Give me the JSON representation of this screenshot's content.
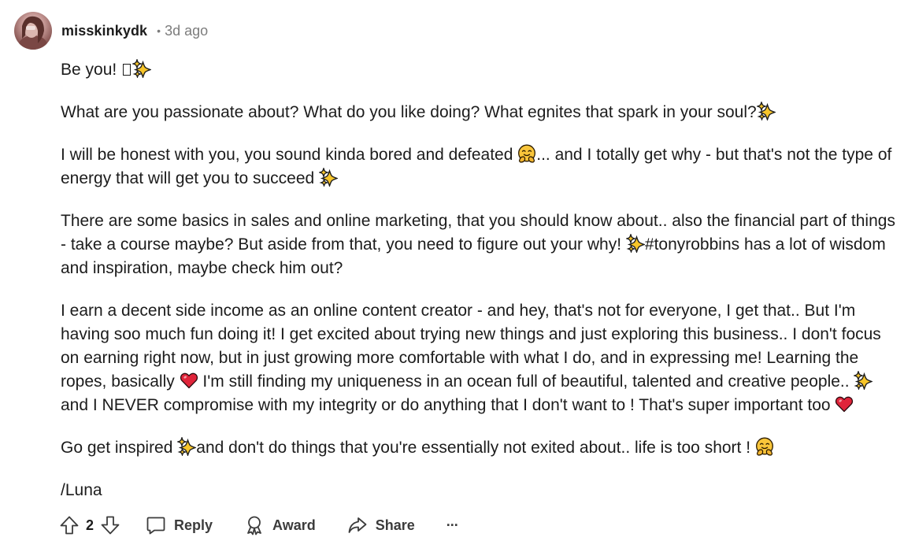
{
  "comment": {
    "author": "misskinkydk",
    "separator": "•",
    "timestamp": "3d ago",
    "paragraphs": [
      {
        "parts": [
          {
            "t": "text",
            "v": "Be you! "
          },
          {
            "t": "missing"
          },
          {
            "t": "sparkle"
          }
        ]
      },
      {
        "parts": [
          {
            "t": "text",
            "v": "What are you passionate about? What do you like doing? What egnites that spark in your soul?"
          },
          {
            "t": "sparkle"
          }
        ]
      },
      {
        "parts": [
          {
            "t": "text",
            "v": "I will be honest with you, you sound kinda bored and defeated "
          },
          {
            "t": "hug"
          },
          {
            "t": "text",
            "v": "... and I totally get why - but that's not the type of energy that will get you to succeed "
          },
          {
            "t": "sparkle"
          }
        ]
      },
      {
        "parts": [
          {
            "t": "text",
            "v": "There are some basics in sales and online marketing, that you should know about.. also the financial part of things - take a course maybe? But aside from that, you need to figure out your why! "
          },
          {
            "t": "sparkle"
          },
          {
            "t": "text",
            "v": "#tonyrobbins has a lot of wisdom and inspiration, maybe check him out?"
          }
        ]
      },
      {
        "parts": [
          {
            "t": "text",
            "v": "I earn a decent side income as an online content creator - and hey, that's not for everyone, I get that.. But I'm having soo much fun doing it! I get excited about trying new things and just exploring this business.. I don't focus on earning right now, but in just growing more comfortable with what I do, and in expressing me! Learning the ropes, basically "
          },
          {
            "t": "heart"
          },
          {
            "t": "text",
            "v": " I'm still finding my uniqueness in an ocean full of beautiful, talented and creative people.. "
          },
          {
            "t": "sparkle"
          },
          {
            "t": "text",
            "v": " and I NEVER compromise with my integrity or do anything that I don't want to ! That's super important too "
          },
          {
            "t": "heart"
          }
        ]
      },
      {
        "parts": [
          {
            "t": "text",
            "v": "Go get inspired "
          },
          {
            "t": "sparkle"
          },
          {
            "t": "text",
            "v": "and don't do things that you're essentially not exited about.. life is too short ! "
          },
          {
            "t": "hug"
          }
        ]
      },
      {
        "parts": [
          {
            "t": "text",
            "v": "/Luna"
          }
        ]
      }
    ]
  },
  "actions": {
    "vote_count": "2",
    "reply_label": "Reply",
    "award_label": "Award",
    "share_label": "Share",
    "more_label": "···"
  },
  "icons": {
    "upvote": "upvote-arrow-icon",
    "downvote": "downvote-arrow-icon",
    "reply": "speech-bubble-icon",
    "award": "award-ribbon-icon",
    "share": "share-arrow-icon",
    "more": "more-options-icon"
  },
  "colors": {
    "text": "#1c1c1c",
    "muted": "#7c7c7c",
    "action": "#3c3c3c",
    "heart": "#e0243a",
    "sparkle": "#f7c52a"
  }
}
